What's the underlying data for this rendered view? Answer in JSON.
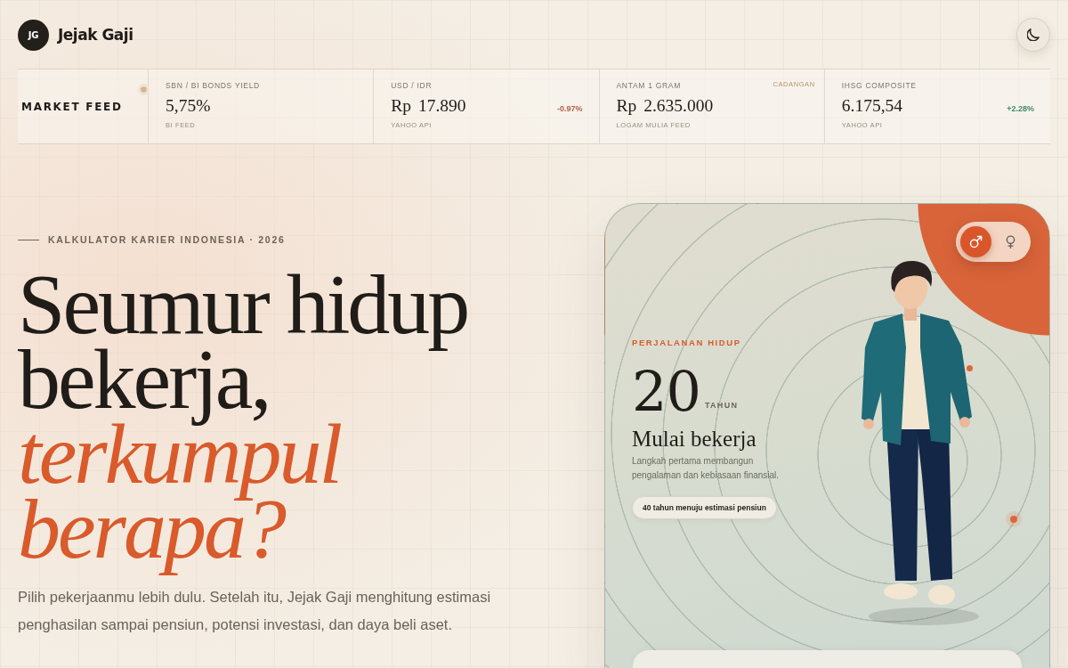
{
  "brand": {
    "initials": "JG",
    "name": "Jejak Gaji"
  },
  "market_feed": {
    "title": "MARKET FEED",
    "items": [
      {
        "label": "SBN / BI BONDS YIELD",
        "value": "5,75%",
        "source": "BI FEED"
      },
      {
        "label": "USD / IDR",
        "value": "Rp 17.890",
        "source": "YAHOO API",
        "change": "-0.97%",
        "color": "#b5604a"
      },
      {
        "label": "ANTAM 1 GRAM",
        "tag": "CADANGAN",
        "value": "Rp 2.635.000",
        "source": "LOGAM MULIA FEED"
      },
      {
        "label": "IHSG COMPOSITE",
        "value": "6.175,54",
        "source": "YAHOO API",
        "change": "+2.28%",
        "color": "#3f8a6b"
      }
    ]
  },
  "hero": {
    "eyebrow": "KALKULATOR KARIER INDONESIA · 2026",
    "headline": "Seumur hidup bekerja, *terkumpul berapa?*",
    "intro": "Pilih pekerjaanmu lebih dulu. Setelah itu, Jejak Gaji menghitung estimasi penghasilan sampai pensiun, potensi investasi, dan daya beli aset."
  },
  "journey_card": {
    "gender_options": [
      {
        "kind": "male",
        "selected": true
      },
      {
        "kind": "female",
        "selected": false
      }
    ],
    "eyebrow": "PERJALANAN HIDUP",
    "age": "20",
    "age_unit": "TAHUN",
    "stage": "Mulai bekerja",
    "description": "Langkah pertama membangun pengalaman dan kebiasaan finansial.",
    "countdown": "40 tahun menuju estimasi pensiun"
  }
}
